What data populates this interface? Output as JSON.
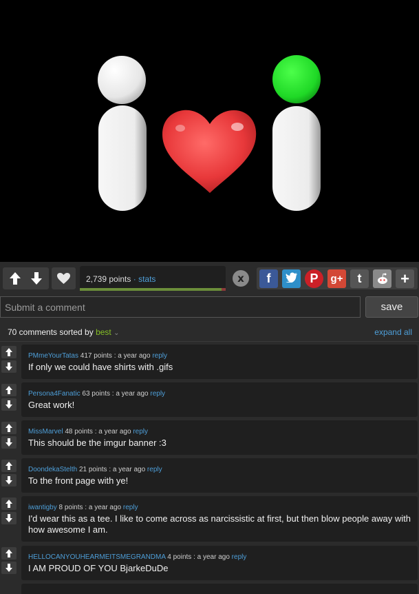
{
  "image": {
    "description_icons": [
      "i-letter-white",
      "heart-red",
      "i-letter-green-dot"
    ],
    "colors": {
      "background": "#000000",
      "heart": "#e8383a",
      "dot_green": "#22e02a",
      "letter_white": "#f2f2f2"
    }
  },
  "actions": {
    "upvote_icon": "arrow-up-icon",
    "downvote_icon": "arrow-down-icon",
    "favorite_icon": "heart-icon",
    "points": "2,739 points",
    "separator": "·",
    "stats_label": "stats",
    "close_label": "x",
    "share": [
      {
        "name": "facebook",
        "glyph": "f",
        "color": "#3b5998"
      },
      {
        "name": "twitter",
        "glyph": "t",
        "color": "#2e8fc9"
      },
      {
        "name": "pinterest",
        "glyph": "P",
        "color": "#cb2027"
      },
      {
        "name": "google-plus",
        "glyph": "g+",
        "color": "#d34836"
      },
      {
        "name": "tumblr",
        "glyph": "t",
        "color": "#555555"
      },
      {
        "name": "reddit",
        "glyph": "r",
        "color": "#8a8a8a"
      },
      {
        "name": "more",
        "glyph": "+",
        "color": "#555555"
      }
    ],
    "score_fraction": 0.97
  },
  "comment_form": {
    "placeholder": "Submit a comment",
    "save_label": "save"
  },
  "comments_header": {
    "count_text": "70 comments sorted by",
    "sort": "best",
    "expand_label": "expand all"
  },
  "comments": [
    {
      "author": "PMmeYourTatas",
      "points": "417 points",
      "time": ": a year ago",
      "reply": "reply",
      "text": "If only we could have shirts with .gifs"
    },
    {
      "author": "Persona4Fanatic",
      "points": "63 points",
      "time": ": a year ago",
      "reply": "reply",
      "text": "Great work!"
    },
    {
      "author": "MissMarvel",
      "points": "48 points",
      "time": ": a year ago",
      "reply": "reply",
      "text": "This should be the imgur banner :3"
    },
    {
      "author": "DoondekaStelth",
      "points": "21 points",
      "time": ": a year ago",
      "reply": "reply",
      "text": "To the front page with ye!"
    },
    {
      "author": "iwantigby",
      "points": "8 points",
      "time": ": a year ago",
      "reply": "reply",
      "text": "I'd wear this as a tee. I like to come across as narcissistic at first, but then blow people away with how awesome I am."
    },
    {
      "author": "HELLOCANYOUHEARMEITSMEGRANDMA",
      "points": "4 points",
      "time": ": a year ago",
      "reply": "reply",
      "text": "I AM PROUD OF YOU BjarkeDuDe"
    }
  ]
}
